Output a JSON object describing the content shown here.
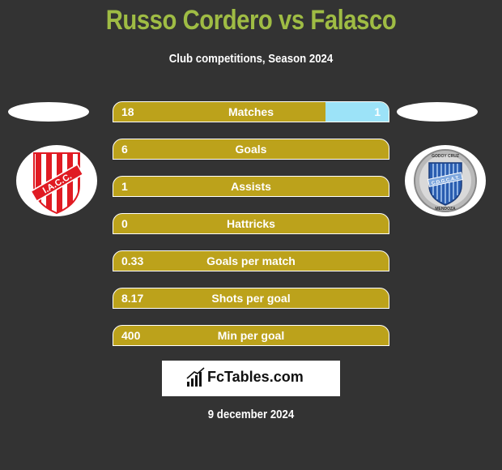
{
  "header": {
    "title": "Russo Cordero vs Falasco",
    "subtitle": "Club competitions, Season 2024"
  },
  "teams": {
    "left": {
      "name": "I.A.C.C.",
      "logo": "iacc-crest-icon"
    },
    "right": {
      "name": "Godoy Cruz",
      "logo": "godoy-cruz-crest-icon",
      "crest_top": "GODOY CRUZ",
      "crest_mid": "C.D.G.C.A.T.",
      "crest_bottom": "MENDOZA"
    }
  },
  "colors": {
    "title": "#9fbc44",
    "left_bar": "#bca21b",
    "right_bar": "#9ce3f8",
    "background": "#333333"
  },
  "stats": [
    {
      "label": "Matches",
      "left": "18",
      "right": "1",
      "right_share": 0.23
    },
    {
      "label": "Goals",
      "left": "6",
      "right": "",
      "right_share": 0
    },
    {
      "label": "Assists",
      "left": "1",
      "right": "",
      "right_share": 0
    },
    {
      "label": "Hattricks",
      "left": "0",
      "right": "",
      "right_share": 0
    },
    {
      "label": "Goals per match",
      "left": "0.33",
      "right": "",
      "right_share": 0
    },
    {
      "label": "Shots per goal",
      "left": "8.17",
      "right": "",
      "right_share": 0
    },
    {
      "label": "Min per goal",
      "left": "400",
      "right": "",
      "right_share": 0
    }
  ],
  "brand": {
    "name": "FcTables.com",
    "icon": "bar-chart-icon"
  },
  "date": "9 december 2024"
}
